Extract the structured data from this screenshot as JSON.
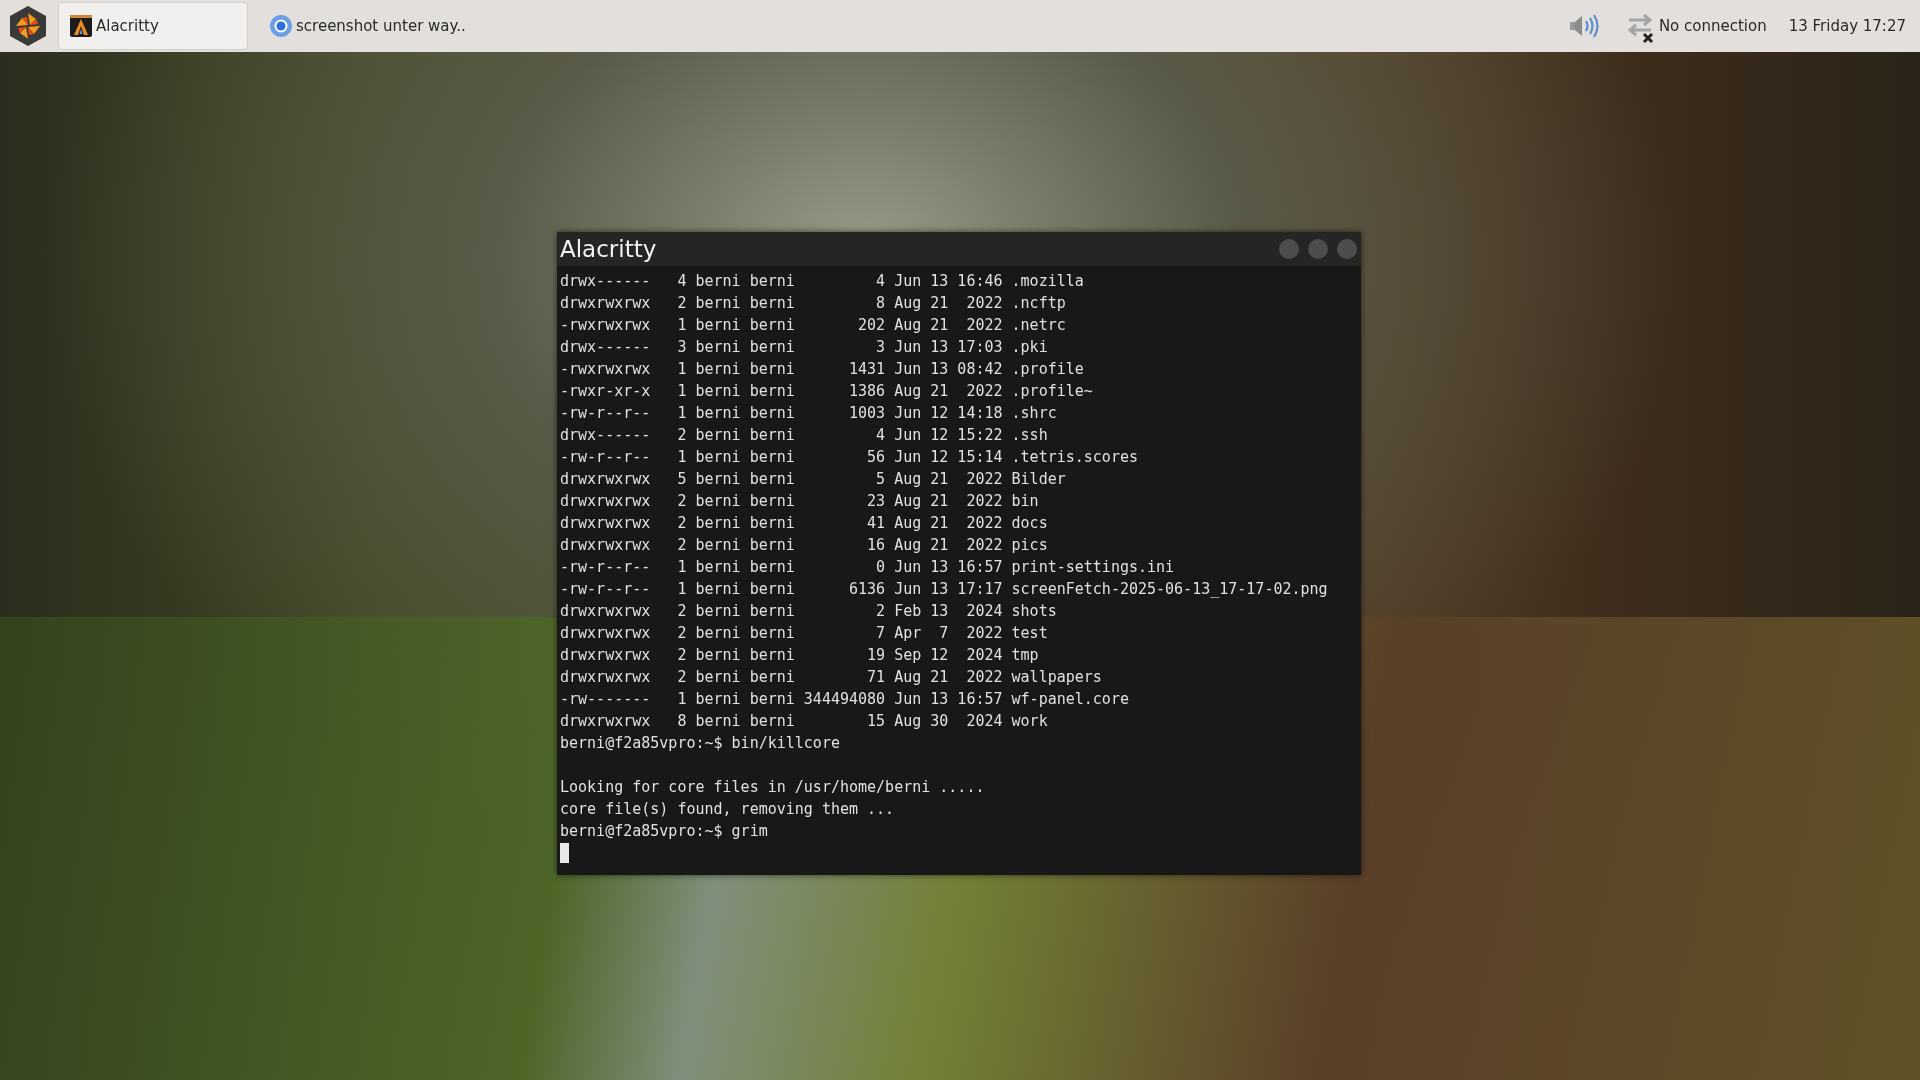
{
  "taskbar": {
    "tasks": [
      {
        "label": "Alacritty",
        "selected": true,
        "kind": "terminal"
      },
      {
        "label": "screenshot unter way..",
        "selected": false,
        "kind": "browser"
      }
    ],
    "network": {
      "label": "No connection"
    },
    "clock": "13 Friday 17:27"
  },
  "window": {
    "title": "Alacritty",
    "lines": [
      {
        "kind": "text",
        "text": "drwx------   4 berni berni         4 Jun 13 16:46 .mozilla"
      },
      {
        "kind": "text",
        "text": "drwxrwxrwx   2 berni berni         8 Aug 21  2022 .ncftp"
      },
      {
        "kind": "text",
        "text": "-rwxrwxrwx   1 berni berni       202 Aug 21  2022 .netrc"
      },
      {
        "kind": "text",
        "text": "drwx------   3 berni berni         3 Jun 13 17:03 .pki"
      },
      {
        "kind": "text",
        "text": "-rwxrwxrwx   1 berni berni      1431 Jun 13 08:42 .profile"
      },
      {
        "kind": "text",
        "text": "-rwxr-xr-x   1 berni berni      1386 Aug 21  2022 .profile~"
      },
      {
        "kind": "text",
        "text": "-rw-r--r--   1 berni berni      1003 Jun 12 14:18 .shrc"
      },
      {
        "kind": "text",
        "text": "drwx------   2 berni berni         4 Jun 12 15:22 .ssh"
      },
      {
        "kind": "text",
        "text": "-rw-r--r--   1 berni berni        56 Jun 12 15:14 .tetris.scores"
      },
      {
        "kind": "text",
        "text": "drwxrwxrwx   5 berni berni         5 Aug 21  2022 Bilder"
      },
      {
        "kind": "text",
        "text": "drwxrwxrwx   2 berni berni        23 Aug 21  2022 bin"
      },
      {
        "kind": "text",
        "text": "drwxrwxrwx   2 berni berni        41 Aug 21  2022 docs"
      },
      {
        "kind": "text",
        "text": "drwxrwxrwx   2 berni berni        16 Aug 21  2022 pics"
      },
      {
        "kind": "text",
        "text": "-rw-r--r--   1 berni berni         0 Jun 13 16:57 print-settings.ini"
      },
      {
        "kind": "text",
        "text": "-rw-r--r--   1 berni berni      6136 Jun 13 17:17 screenFetch-2025-06-13_17-17-02.png"
      },
      {
        "kind": "text",
        "text": "drwxrwxrwx   2 berni berni         2 Feb 13  2024 shots"
      },
      {
        "kind": "text",
        "text": "drwxrwxrwx   2 berni berni         7 Apr  7  2022 test"
      },
      {
        "kind": "text",
        "text": "drwxrwxrwx   2 berni berni        19 Sep 12  2024 tmp"
      },
      {
        "kind": "text",
        "text": "drwxrwxrwx   2 berni berni        71 Aug 21  2022 wallpapers"
      },
      {
        "kind": "text",
        "text": "-rw-------   1 berni berni 344494080 Jun 13 16:57 wf-panel.core"
      },
      {
        "kind": "text",
        "text": "drwxrwxrwx   8 berni berni        15 Aug 30  2024 work"
      },
      {
        "kind": "text",
        "text": "berni@f2a85vpro:~$ bin/killcore"
      },
      {
        "kind": "blank"
      },
      {
        "kind": "text",
        "text": "Looking for core files in /usr/home/berni ....."
      },
      {
        "kind": "text",
        "text": "core file(s) found, removing them ..."
      },
      {
        "kind": "text",
        "text": "berni@f2a85vpro:~$ grim"
      },
      {
        "kind": "cursor"
      }
    ]
  }
}
